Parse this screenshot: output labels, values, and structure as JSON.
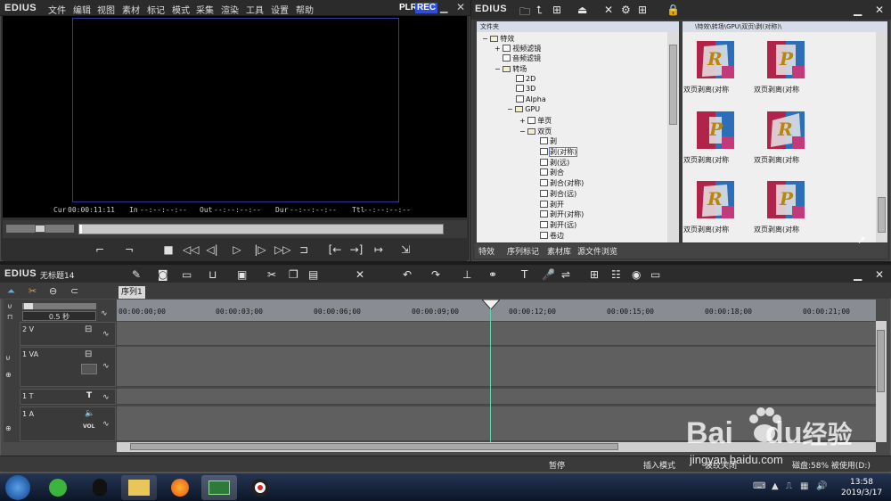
{
  "player": {
    "brand": "EDIUS",
    "menu": [
      "文件",
      "编辑",
      "视图",
      "素材",
      "标记",
      "模式",
      "采集",
      "渲染",
      "工具",
      "设置",
      "帮助"
    ],
    "plr": "PLR",
    "rec": "REC",
    "timecodes": [
      {
        "label": "Cur",
        "value": "00:00:11:11"
      },
      {
        "label": "In",
        "value": "--:--:--:--"
      },
      {
        "label": "Out",
        "value": "--:--:--:--"
      },
      {
        "label": "Dur",
        "value": "--:--:--:--"
      },
      {
        "label": "Ttl",
        "value": "--:--:--:--"
      }
    ]
  },
  "bin": {
    "brand": "EDIUS",
    "folder_header": "文件夹",
    "path": "\\特效\\转场\\GPU\\双页\\剥(对称)\\",
    "tree": [
      {
        "label": "特效",
        "kind": "folder",
        "expand": "−"
      },
      {
        "label": "视频滤镜",
        "kind": "fx",
        "expand": "+"
      },
      {
        "label": "音频滤镜",
        "kind": "fx",
        "expand": ""
      },
      {
        "label": "转场",
        "kind": "folder",
        "expand": "−"
      },
      {
        "label": "2D",
        "kind": "fx",
        "expand": ""
      },
      {
        "label": "3D",
        "kind": "fx",
        "expand": ""
      },
      {
        "label": "Alpha",
        "kind": "fx",
        "expand": ""
      },
      {
        "label": "GPU",
        "kind": "folder",
        "expand": "−"
      },
      {
        "label": "单页",
        "kind": "fx",
        "expand": "+"
      },
      {
        "label": "双页",
        "kind": "folder",
        "expand": "−"
      },
      {
        "label": "剥",
        "kind": "fx",
        "expand": ""
      },
      {
        "label": "剥(对称)",
        "kind": "fx",
        "expand": "",
        "selected": true
      },
      {
        "label": "剥(远)",
        "kind": "fx",
        "expand": ""
      },
      {
        "label": "剥合",
        "kind": "fx",
        "expand": ""
      },
      {
        "label": "剥合(对称)",
        "kind": "fx",
        "expand": ""
      },
      {
        "label": "剥合(远)",
        "kind": "fx",
        "expand": ""
      },
      {
        "label": "剥开",
        "kind": "fx",
        "expand": ""
      },
      {
        "label": "剥开(对称)",
        "kind": "fx",
        "expand": ""
      },
      {
        "label": "剥开(远)",
        "kind": "fx",
        "expand": ""
      },
      {
        "label": "卷边",
        "kind": "fx",
        "expand": ""
      }
    ],
    "thumbnails": [
      {
        "label": "双页剥离(对称",
        "letter": "R"
      },
      {
        "label": "双页剥离(对称",
        "letter": "P"
      },
      {
        "label": "双页剥离(对称",
        "letter": "P"
      },
      {
        "label": "双页剥离(对称",
        "letter": "R"
      },
      {
        "label": "双页剥离(对称",
        "letter": "R"
      },
      {
        "label": "双页剥离(对称",
        "letter": "P"
      }
    ],
    "tabs": [
      "特效",
      "序列标记",
      "素材库",
      "源文件浏览"
    ]
  },
  "timeline": {
    "brand": "EDIUS",
    "project": "无标题14",
    "sequence_tab": "序列1",
    "zoom": "0.5 秒",
    "ruler": [
      "00:00:00;00",
      "00:00:03;00",
      "00:00:06;00",
      "00:00:09;00",
      "00:00:12;00",
      "00:00:15;00",
      "00:00:18;00",
      "00:00:21;00"
    ],
    "tracks": [
      {
        "name": "2 V"
      },
      {
        "name": "1 VA"
      },
      {
        "name": "1 T"
      },
      {
        "name": "1 A"
      }
    ],
    "status": [
      "暂停",
      "插入模式",
      "波纹关闭",
      "磁盘:58% 被使用(D:)"
    ]
  },
  "taskbar": {
    "time": "13:58",
    "date": "2019/3/17"
  },
  "watermark": {
    "text": "Bai",
    "text2": "du",
    "text3": "经验",
    "url": "jingyan.baidu.com"
  },
  "colors": {
    "panel": "#2f2f2f",
    "accent_blue": "#2f3a9e",
    "playhead": "#5fd3b0",
    "rec": "#2e4fd6",
    "thumb_red": "#b1244a",
    "thumb_blue": "#2c6fb8"
  }
}
